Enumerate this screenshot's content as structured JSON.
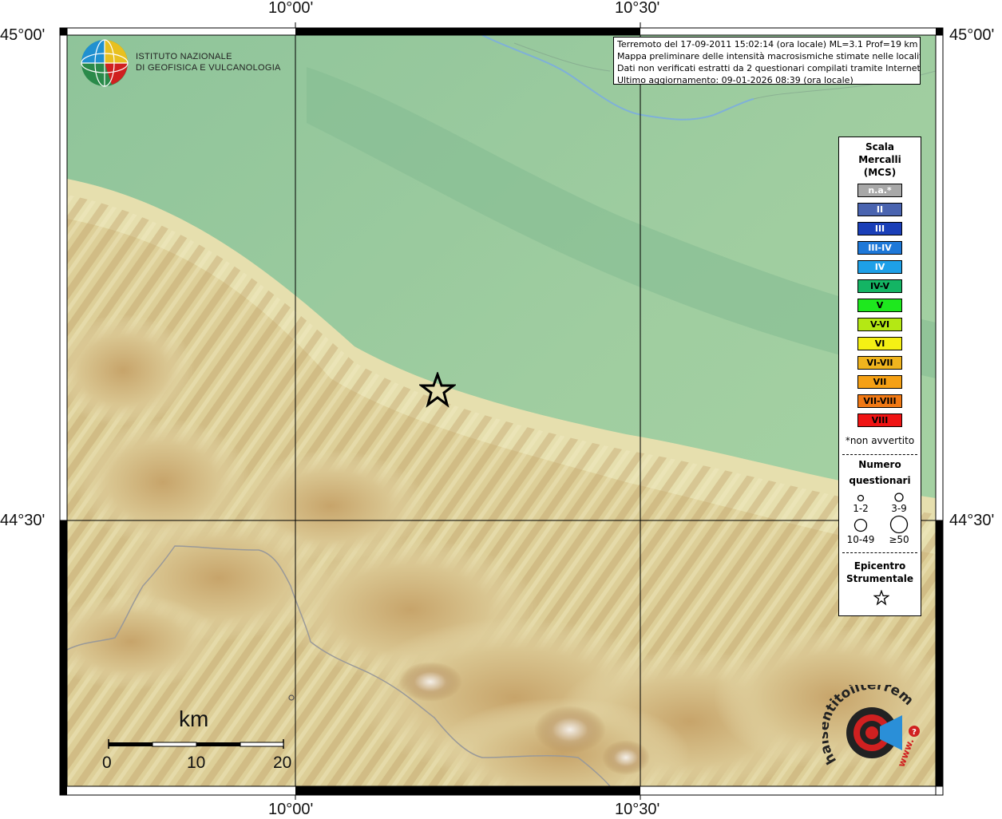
{
  "coords": {
    "top_left": "10°00'",
    "top_right": "10°30'",
    "bottom_left": "10°00'",
    "bottom_right": "10°30'",
    "left_top": "45°00'",
    "left_mid": "44°30'",
    "right_top": "45°00'",
    "right_mid": "44°30'"
  },
  "info": {
    "line1": "Terremoto del 17-09-2011 15:02:14 (ora locale) ML=3.1 Prof=19 km",
    "line2": "Mappa preliminare delle intensità macrosismiche stimate nelle località",
    "line3": "Dati non verificati estratti da 2 questionari compilati tramite Internet.",
    "line4": "Ultimo aggiornamento: 09-01-2026 08:39 (ora locale)"
  },
  "ingv": {
    "line1": "ISTITUTO NAZIONALE",
    "line2": "DI GEOFISICA E VULCANOLOGIA"
  },
  "legend": {
    "title1": "Scala",
    "title2": "Mercalli",
    "title3": "(MCS)",
    "intensities": [
      {
        "label": "n.a.*",
        "color": "#a8a8a8",
        "text": "#ffffff"
      },
      {
        "label": "II",
        "color": "#4a64b0",
        "text": "#ffffff"
      },
      {
        "label": "III",
        "color": "#1a3fb8",
        "text": "#ffffff"
      },
      {
        "label": "III-IV",
        "color": "#1e78d8",
        "text": "#ffffff"
      },
      {
        "label": "IV",
        "color": "#1ea0e8",
        "text": "#ffffff"
      },
      {
        "label": "IV-V",
        "color": "#14b464",
        "text": "#000000"
      },
      {
        "label": "V",
        "color": "#1ee81e",
        "text": "#000000"
      },
      {
        "label": "V-VI",
        "color": "#b4e814",
        "text": "#000000"
      },
      {
        "label": "VI",
        "color": "#f5f014",
        "text": "#000000"
      },
      {
        "label": "VI-VII",
        "color": "#f0b41e",
        "text": "#000000"
      },
      {
        "label": "VII",
        "color": "#f5a014",
        "text": "#000000"
      },
      {
        "label": "VII-VIII",
        "color": "#f07814",
        "text": "#000000"
      },
      {
        "label": "VIII",
        "color": "#f01414",
        "text": "#000000"
      }
    ],
    "not_felt": "*non avvertito",
    "questionnaires_title1": "Numero",
    "questionnaires_title2": "questionari",
    "q1": "1-2",
    "q2": "3-9",
    "q3": "10-49",
    "q4": "≥50",
    "epicenter_title1": "Epicentro",
    "epicenter_title2": "Strumentale"
  },
  "scalebar": {
    "unit": "km",
    "ticks": [
      "0",
      "10",
      "20"
    ]
  },
  "haisentito": {
    "text": "haisentitoilterremoto.it",
    "www": "www."
  }
}
